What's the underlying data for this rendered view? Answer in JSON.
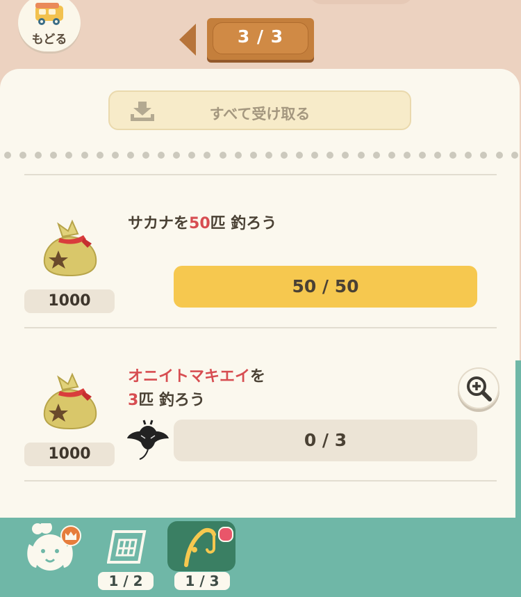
{
  "header": {
    "back_label": "もどる",
    "page_indicator": "3 / 3"
  },
  "claim_all": {
    "label": "すべて受け取る"
  },
  "quests": [
    {
      "title_pre": "サカナを",
      "title_hl": "50",
      "title_post": "匹 釣ろう",
      "reward": "1000",
      "progress": "50 / 50",
      "progress_fraction": 1.0,
      "status_color": "#f6c84f"
    },
    {
      "title_line1_hl": "オニイトマキエイ",
      "title_line1_post": "を",
      "title_line2_hl": "3",
      "title_line2_post": "匹 釣ろう",
      "reward": "1000",
      "progress": "0 / 3",
      "progress_fraction": 0.0,
      "target_icon": "manta-ray-icon",
      "status_color": "#ece4d6"
    }
  ],
  "bottom_nav": {
    "items": [
      {
        "icon": "isabelle-icon",
        "label": ""
      },
      {
        "icon": "calendar-icon",
        "label": "1 / 2"
      },
      {
        "icon": "fishing-rod-icon",
        "label": "1 / 3",
        "active": true
      }
    ]
  },
  "colors": {
    "accent_yellow": "#f6c84f",
    "highlight_red": "#d74d51",
    "nav_teal": "#6fb7a7",
    "nav_active": "#3a7f63"
  }
}
